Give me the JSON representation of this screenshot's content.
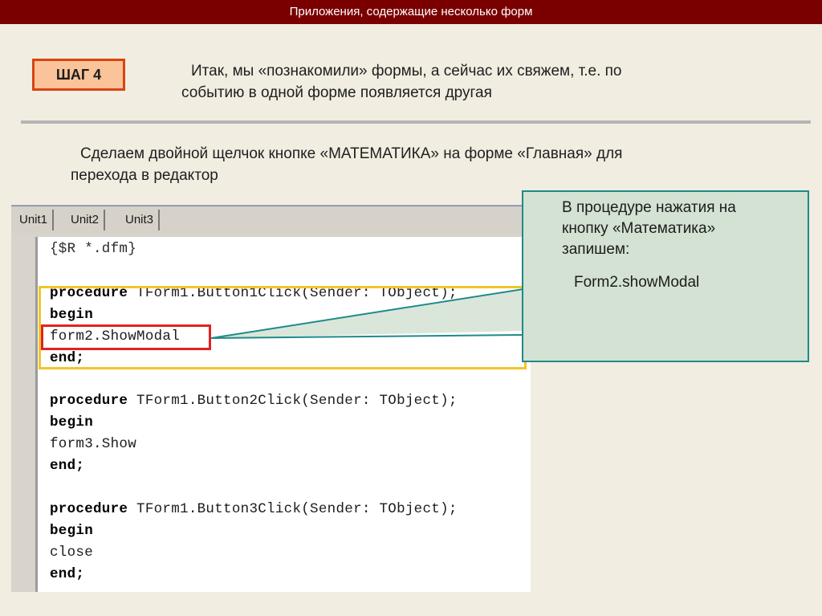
{
  "header": {
    "title": "Приложения, содержащие несколько форм"
  },
  "step": {
    "label": "ШАГ 4"
  },
  "intro": {
    "line1": "Итак, мы «познакомили» формы, а сейчас их свяжем, т.е. по",
    "line2": "событию в одной форме появляется другая"
  },
  "instruction": {
    "line1": "Сделаем двойной щелчок кнопке «МАТЕМАТИКА» на форме «Главная» для",
    "line2": "перехода в редактор"
  },
  "editor": {
    "tabs": [
      "Unit1",
      "Unit2",
      "Unit3"
    ],
    "code": {
      "comment": "{$R *.dfm}",
      "proc1": {
        "keyword": "procedure",
        "signature": " TForm1.Button1Click(Sender: TObject);",
        "begin": "begin",
        "body": "form2.ShowModal",
        "end": "end;"
      },
      "proc2": {
        "keyword": "procedure",
        "signature": " TForm1.Button2Click(Sender: TObject);",
        "begin": "begin",
        "body": "form3.Show",
        "end": "end;"
      },
      "proc3": {
        "keyword": "procedure",
        "signature": " TForm1.Button3Click(Sender: TObject);",
        "begin": "begin",
        "body": "close",
        "end": "end;"
      }
    }
  },
  "callout": {
    "line1": "В процедуре нажатия на",
    "line2": "кнопку «Математика»",
    "line3": "запишем:",
    "code": "Form2.showModal"
  },
  "colors": {
    "title_bar": "#7a0000",
    "badge_fill": "#fbc39a",
    "badge_border": "#d94410",
    "highlight_yellow": "#f0c62a",
    "highlight_red": "#e32222",
    "callout_fill": "#d3e2d2",
    "callout_border": "#1e8a8a"
  }
}
